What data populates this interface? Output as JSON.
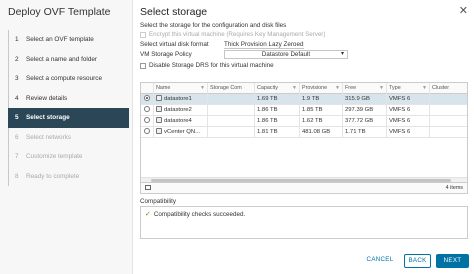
{
  "wizard": {
    "title": "Deploy OVF Template",
    "steps": [
      {
        "num": "1",
        "label": "Select an OVF template",
        "state": "done"
      },
      {
        "num": "2",
        "label": "Select a name and folder",
        "state": "done"
      },
      {
        "num": "3",
        "label": "Select a compute resource",
        "state": "done"
      },
      {
        "num": "4",
        "label": "Review details",
        "state": "done"
      },
      {
        "num": "5",
        "label": "Select storage",
        "state": "active"
      },
      {
        "num": "6",
        "label": "Select networks",
        "state": "disabled"
      },
      {
        "num": "7",
        "label": "Customize template",
        "state": "disabled"
      },
      {
        "num": "8",
        "label": "Ready to complete",
        "state": "disabled"
      }
    ]
  },
  "page": {
    "title": "Select storage",
    "description": "Select the storage for the configuration and disk files",
    "encrypt_label": "Encrypt this virtual machine (Requires Key Management Server)",
    "disk_format_label": "Select virtual disk format",
    "disk_format_value": "Thick Provision Lazy Zeroed",
    "policy_label": "VM Storage Policy",
    "policy_value": "Datastore Default",
    "drs_label": "Disable Storage DRS for this virtual machine"
  },
  "grid": {
    "columns": [
      "Name",
      "Storage Com",
      "Capacity",
      "Provisione",
      "Free",
      "Type",
      "Cluster"
    ],
    "rows": [
      {
        "name": "datastore1",
        "compat": "",
        "capacity": "1.69 TB",
        "provisioned": "1.9 TB",
        "free": "315.9 GB",
        "type": "VMFS 6",
        "cluster": "",
        "selected": true
      },
      {
        "name": "datastore2",
        "compat": "",
        "capacity": "1.86 TB",
        "provisioned": "1.85 TB",
        "free": "297.39 GB",
        "type": "VMFS 6",
        "cluster": "",
        "selected": false
      },
      {
        "name": "datastore4",
        "compat": "",
        "capacity": "1.86 TB",
        "provisioned": "1.62 TB",
        "free": "377.72 GB",
        "type": "VMFS 6",
        "cluster": "",
        "selected": false
      },
      {
        "name": "vCenter QN...",
        "compat": "",
        "capacity": "1.81 TB",
        "provisioned": "481.08 GB",
        "free": "1.71 TB",
        "type": "VMFS 6",
        "cluster": "",
        "selected": false
      }
    ],
    "item_count": "4 items"
  },
  "compatibility": {
    "label": "Compatibility",
    "message": "Compatibility checks succeeded."
  },
  "buttons": {
    "cancel": "CANCEL",
    "back": "BACK",
    "next": "NEXT"
  },
  "colors": {
    "active_step_bg": "#2b4656",
    "primary": "#0072a3",
    "selected_row": "#d7e4ec",
    "success": "#4e9a06"
  }
}
